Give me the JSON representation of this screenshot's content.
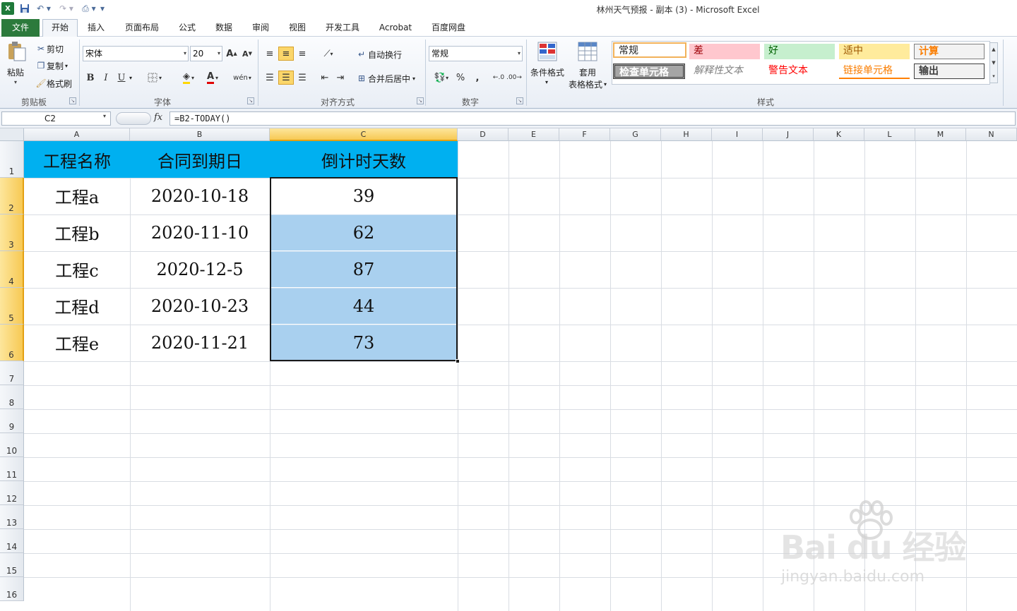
{
  "window": {
    "title": "林州天气预报 - 副本 (3)  -  Microsoft Excel"
  },
  "tabs": [
    "文件",
    "开始",
    "插入",
    "页面布局",
    "公式",
    "数据",
    "审阅",
    "视图",
    "开发工具",
    "Acrobat",
    "百度网盘"
  ],
  "ribbon": {
    "clipboard": {
      "paste": "粘贴",
      "cut": "剪切",
      "copy": "复制",
      "format_painter": "格式刷",
      "label": "剪贴板"
    },
    "font": {
      "name": "宋体",
      "size": "20",
      "bold": "B",
      "italic": "I",
      "underline": "U",
      "label": "字体"
    },
    "alignment": {
      "wrap": "自动换行",
      "merge": "合并后居中",
      "label": "对齐方式"
    },
    "number": {
      "format": "常规",
      "percent": "%",
      "comma": ",",
      "label": "数字"
    },
    "styles": {
      "conditional": "条件格式",
      "table_line1": "套用",
      "table_line2": "表格格式",
      "label": "样式",
      "cells": [
        "常规",
        "差",
        "好",
        "适中",
        "计算",
        "检查单元格",
        "解释性文本",
        "警告文本",
        "链接单元格",
        "输出"
      ]
    }
  },
  "formula_bar": {
    "name_box": "C2",
    "fx": "fx",
    "formula": "=B2-TODAY()"
  },
  "columns": [
    "A",
    "B",
    "C",
    "D",
    "E",
    "F",
    "G",
    "H",
    "I",
    "J",
    "K",
    "L",
    "M",
    "N"
  ],
  "rows": [
    "1",
    "2",
    "3",
    "4",
    "5",
    "6",
    "7",
    "8",
    "9",
    "10",
    "11",
    "12",
    "13",
    "14",
    "15",
    "16"
  ],
  "sheet": {
    "header": [
      "工程名称",
      "合同到期日",
      "倒计时天数"
    ],
    "data": [
      [
        "工程a",
        "2020-10-18",
        "39"
      ],
      [
        "工程b",
        "2020-11-10",
        "62"
      ],
      [
        "工程c",
        "2020-12-5",
        "87"
      ],
      [
        "工程d",
        "2020-10-23",
        "44"
      ],
      [
        "工程e",
        "2020-11-21",
        "73"
      ]
    ]
  },
  "watermark": {
    "brand": "Bai  du 经验",
    "site": "jingyan.baidu.com"
  },
  "colors": {
    "header_fill": "#00b0f0",
    "selection_fill": "#a9d0ef",
    "file_tab": "#2c7a3c",
    "active_header": "#f7c954"
  }
}
